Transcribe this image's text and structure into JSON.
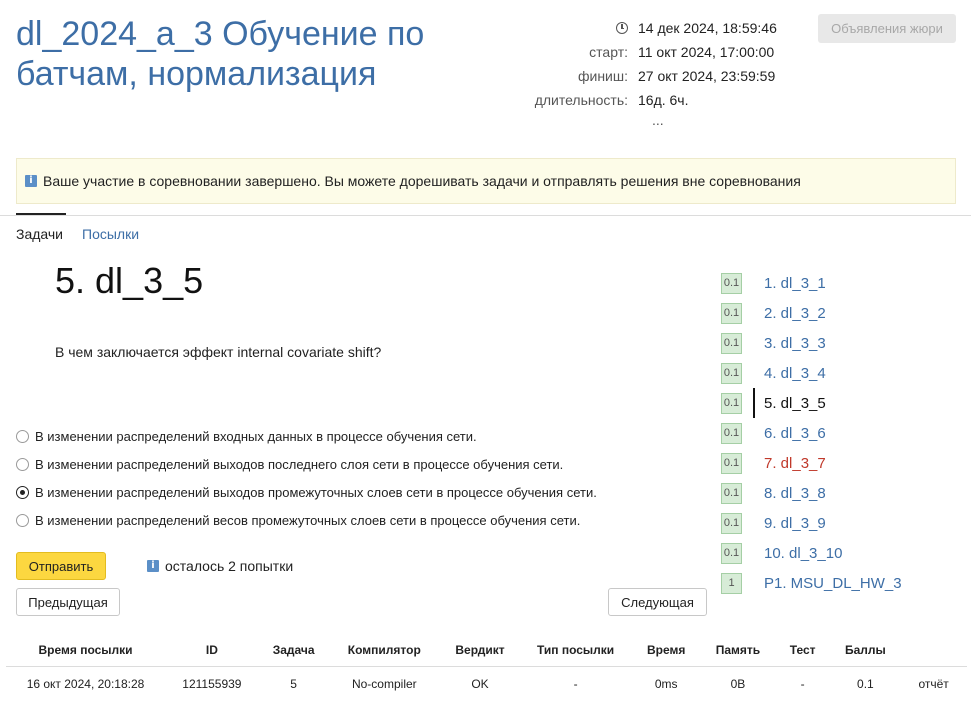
{
  "header": {
    "title": "dl_2024_a_3 Обучение по батчам, нормализация",
    "jury_button": "Объявления жюри"
  },
  "meta": {
    "current_time": "14 дек 2024, 18:59:46",
    "start_label": "старт:",
    "start_value": "11 окт 2024, 17:00:00",
    "finish_label": "финиш:",
    "finish_value": "27 окт 2024, 23:59:59",
    "duration_label": "длительность:",
    "duration_value": "16д. 6ч.",
    "more": "..."
  },
  "notice": {
    "icon": "info-icon",
    "text": "Ваше участие в соревновании завершено. Вы можете дорешивать задачи и отправлять решения вне соревнования"
  },
  "tabs": {
    "problems": "Задачи",
    "submissions": "Посылки"
  },
  "problem": {
    "title": "5. dl_3_5",
    "question": "В чем заключается эффект internal covariate shift?",
    "options": [
      {
        "label": "В изменении распределений входных данных в процессе обучения сети.",
        "checked": false
      },
      {
        "label": "В изменении распределений выходов последнего слоя сети в процессе обучения сети.",
        "checked": false
      },
      {
        "label": "В изменении распределений выходов промежуточных слоев сети в процессе обучения сети.",
        "checked": true
      },
      {
        "label": "В изменении распределений весов промежуточных слоев сети в процессе обучения сети.",
        "checked": false
      }
    ]
  },
  "actions": {
    "submit": "Отправить",
    "attempts": "осталось 2 попытки",
    "prev": "Предыдущая",
    "next": "Следующая"
  },
  "problem_list": [
    {
      "score": "0.1",
      "label": "1. dl_3_1",
      "state": "normal"
    },
    {
      "score": "0.1",
      "label": "2. dl_3_2",
      "state": "normal"
    },
    {
      "score": "0.1",
      "label": "3. dl_3_3",
      "state": "normal"
    },
    {
      "score": "0.1",
      "label": "4. dl_3_4",
      "state": "normal"
    },
    {
      "score": "0.1",
      "label": "5. dl_3_5",
      "state": "current"
    },
    {
      "score": "0.1",
      "label": "6. dl_3_6",
      "state": "normal"
    },
    {
      "score": "0.1",
      "label": "7. dl_3_7",
      "state": "failed"
    },
    {
      "score": "0.1",
      "label": "8. dl_3_8",
      "state": "normal"
    },
    {
      "score": "0.1",
      "label": "9. dl_3_9",
      "state": "normal"
    },
    {
      "score": "0.1",
      "label": "10. dl_3_10",
      "state": "normal"
    },
    {
      "score": "1",
      "label": "P1. MSU_DL_HW_3",
      "state": "normal"
    }
  ],
  "submissions": {
    "headers": [
      "Время посылки",
      "ID",
      "Задача",
      "Компилятор",
      "Вердикт",
      "Тип посылки",
      "Время",
      "Память",
      "Тест",
      "Баллы",
      ""
    ],
    "rows": [
      {
        "time": "16 окт 2024, 20:18:28",
        "id": "121155939",
        "task": "5",
        "compiler": "No-compiler",
        "verdict": "OK",
        "type": "-",
        "runtime": "0ms",
        "memory": "0B",
        "test": "-",
        "points": "0.1",
        "report": "отчёт"
      }
    ]
  },
  "colors": {
    "link": "#3d6ea6",
    "submit": "#fcd740",
    "ok": "#2f9a2f",
    "failed": "#c0392b",
    "badge": "#d7ecd7"
  }
}
